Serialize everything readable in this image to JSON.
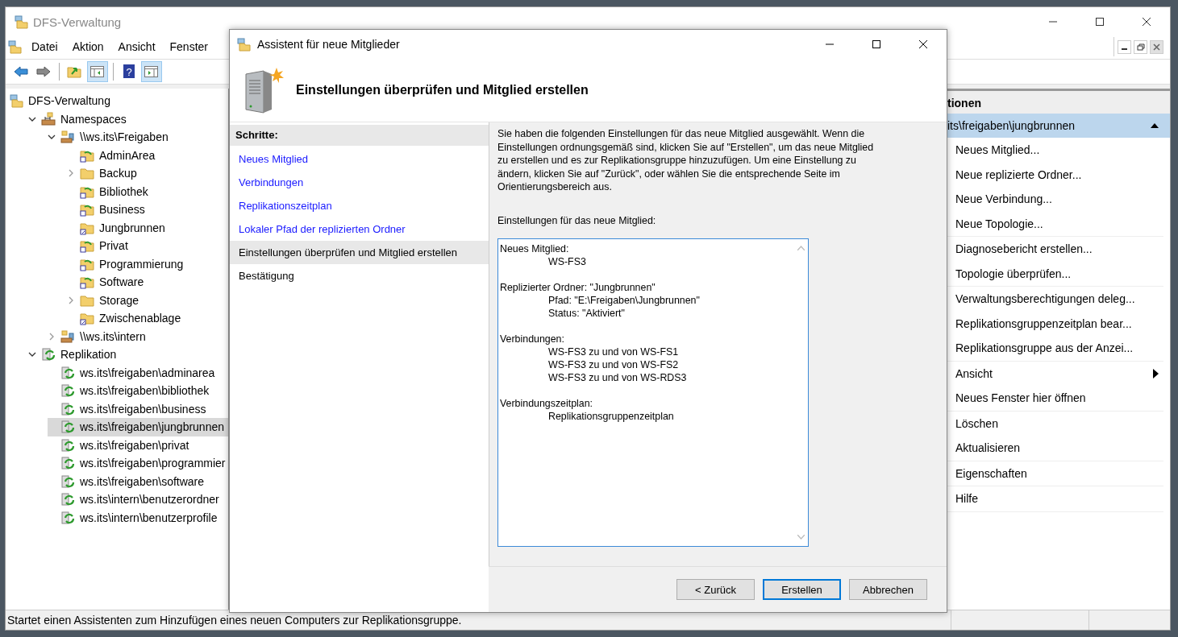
{
  "window": {
    "title": "DFS-Verwaltung"
  },
  "menu": [
    "Datei",
    "Aktion",
    "Ansicht",
    "Fenster"
  ],
  "toolbar": [
    {
      "kind": "back",
      "pressed": false
    },
    {
      "kind": "forward",
      "pressed": false
    },
    {
      "kind": "sep"
    },
    {
      "kind": "up",
      "pressed": false
    },
    {
      "kind": "tree",
      "pressed": true
    },
    {
      "kind": "sep"
    },
    {
      "kind": "help",
      "pressed": false,
      "glyph": "?"
    },
    {
      "kind": "actions",
      "pressed": true
    }
  ],
  "tree": [
    {
      "label": "DFS-Verwaltung",
      "kind": "root",
      "selected": false,
      "children": [
        {
          "label": "Namespaces",
          "kind": "namespaces",
          "expanded": true,
          "selected": false,
          "children": [
            {
              "label": "\\\\ws.its\\Freigaben",
              "kind": "namespace",
              "expanded": true,
              "selected": false,
              "children": [
                {
                  "label": "AdminArea",
                  "kind": "replicated-folder",
                  "selected": false
                },
                {
                  "label": "Backup",
                  "kind": "folder",
                  "expanded": false,
                  "selected": false
                },
                {
                  "label": "Bibliothek",
                  "kind": "replicated-folder",
                  "selected": false
                },
                {
                  "label": "Business",
                  "kind": "replicated-folder",
                  "selected": false
                },
                {
                  "label": "Jungbrunnen",
                  "kind": "link-folder",
                  "selected": false
                },
                {
                  "label": "Privat",
                  "kind": "replicated-folder",
                  "selected": false
                },
                {
                  "label": "Programmierung",
                  "kind": "replicated-folder",
                  "selected": false
                },
                {
                  "label": "Software",
                  "kind": "replicated-folder",
                  "selected": false
                },
                {
                  "label": "Storage",
                  "kind": "folder",
                  "expanded": false,
                  "selected": false
                },
                {
                  "label": "Zwischenablage",
                  "kind": "link-folder",
                  "selected": false
                }
              ]
            },
            {
              "label": "\\\\ws.its\\intern",
              "kind": "namespace",
              "expanded": false,
              "selected": false
            }
          ]
        },
        {
          "label": "Replikation",
          "kind": "replication",
          "expanded": true,
          "selected": false,
          "children": [
            {
              "label": "ws.its\\freigaben\\adminarea",
              "kind": "group",
              "selected": false
            },
            {
              "label": "ws.its\\freigaben\\bibliothek",
              "kind": "group",
              "selected": false
            },
            {
              "label": "ws.its\\freigaben\\business",
              "kind": "group",
              "selected": false
            },
            {
              "label": "ws.its\\freigaben\\jungbrunnen",
              "kind": "group",
              "selected": true
            },
            {
              "label": "ws.its\\freigaben\\privat",
              "kind": "group",
              "selected": false
            },
            {
              "label": "ws.its\\freigaben\\programmier",
              "kind": "group",
              "selected": false
            },
            {
              "label": "ws.its\\freigaben\\software",
              "kind": "group",
              "selected": false
            },
            {
              "label": "ws.its\\intern\\benutzerordner",
              "kind": "group",
              "selected": false
            },
            {
              "label": "ws.its\\intern\\benutzerprofile",
              "kind": "group",
              "selected": false
            }
          ]
        }
      ]
    }
  ],
  "actions": {
    "title": "tionen",
    "group": {
      "label": "its\\freigaben\\jungbrunnen",
      "expanded": true
    },
    "sections": [
      [
        {
          "label": "Neues Mitglied...",
          "submenu": false
        },
        {
          "label": "Neue replizierte Ordner...",
          "submenu": false
        },
        {
          "label": "Neue Verbindung...",
          "submenu": false
        },
        {
          "label": "Neue Topologie...",
          "submenu": false
        }
      ],
      [
        {
          "label": "Diagnosebericht erstellen...",
          "submenu": false
        },
        {
          "label": "Topologie überprüfen...",
          "submenu": false
        }
      ],
      [
        {
          "label": "Verwaltungsberechtigungen deleg...",
          "submenu": false
        },
        {
          "label": "Replikationsgruppenzeitplan bear...",
          "submenu": false
        },
        {
          "label": "Replikationsgruppe aus der Anzei...",
          "submenu": false
        }
      ],
      [
        {
          "label": "Ansicht",
          "submenu": true
        },
        {
          "label": "Neues Fenster hier öffnen",
          "submenu": false
        }
      ],
      [
        {
          "label": "Löschen",
          "submenu": false
        },
        {
          "label": "Aktualisieren",
          "submenu": false
        }
      ],
      [
        {
          "label": "Eigenschaften",
          "submenu": false
        }
      ],
      [
        {
          "label": "Hilfe",
          "submenu": false
        }
      ]
    ]
  },
  "status_bar": "Startet einen Assistenten zum Hinzufügen eines neuen Computers zur Replikationsgruppe.",
  "dialog": {
    "title": "Assistent für neue Mitglieder",
    "heading": "Einstellungen überprüfen und Mitglied erstellen",
    "steps_title": "Schritte:",
    "steps": [
      {
        "label": "Neues Mitglied",
        "kind": "link",
        "selected": false
      },
      {
        "label": "Verbindungen",
        "kind": "link",
        "selected": false
      },
      {
        "label": "Replikationszeitplan",
        "kind": "link",
        "selected": false
      },
      {
        "label": "Lokaler Pfad der replizierten Ordner",
        "kind": "link",
        "selected": false
      },
      {
        "label": "Einstellungen überprüfen und Mitglied erstellen",
        "kind": "plain",
        "selected": true
      },
      {
        "label": "Bestätigung",
        "kind": "plain",
        "selected": false
      }
    ],
    "intro": "Sie haben die folgenden Einstellungen für das neue Mitglied ausgewählt. Wenn die Einstellungen ordnungsgemäß sind, klicken Sie auf \"Erstellen\", um das neue Mitglied zu erstellen und es zur Replikationsgruppe hinzuzufügen. Um eine Einstellung zu ändern, klicken Sie auf \"Zurück\", oder wählen Sie die entsprechende Seite im Orientierungsbereich aus.",
    "summary_label": "Einstellungen für das neue Mitglied:",
    "summary": [
      {
        "label": "Neues Mitglied:",
        "values": [
          "WS-FS3"
        ]
      },
      {
        "label": "Replizierter Ordner: \"Jungbrunnen\"",
        "values": [
          "Pfad: \"E:\\Freigaben\\Jungbrunnen\"",
          "Status: \"Aktiviert\""
        ]
      },
      {
        "label": "Verbindungen:",
        "values": [
          "WS-FS3 zu und von WS-FS1",
          "WS-FS3 zu und von WS-FS2",
          "WS-FS3 zu und von WS-RDS3"
        ]
      },
      {
        "label": "Verbindungszeitplan:",
        "values": [
          "Replikationsgruppenzeitplan"
        ]
      }
    ],
    "buttons": [
      {
        "label": "< Zurück",
        "default": false
      },
      {
        "label": "Erstellen",
        "default": true
      },
      {
        "label": "Abbrechen",
        "default": false
      }
    ]
  }
}
